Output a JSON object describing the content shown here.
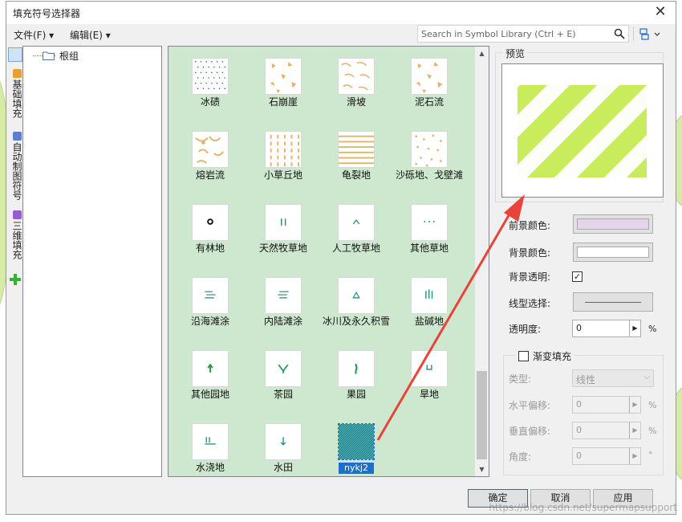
{
  "window": {
    "title": "填充符号选择器"
  },
  "menu": [
    {
      "label": "文件(F)"
    },
    {
      "label": "编辑(E)"
    }
  ],
  "search": {
    "placeholder": "Search in Symbol Library (Ctrl + E)"
  },
  "left_tabs": [
    {
      "label": "基础填充"
    },
    {
      "label": "自动制图符号"
    },
    {
      "label": "三维填充"
    }
  ],
  "tree": {
    "root_label": "根组"
  },
  "symbols": [
    {
      "label": "冰碛",
      "pattern": "dots"
    },
    {
      "label": "石崩崖",
      "pattern": "blobs"
    },
    {
      "label": "滑坡",
      "pattern": "arcs"
    },
    {
      "label": "泥石流",
      "pattern": "blobs"
    },
    {
      "label": "熔岩流",
      "pattern": "lava"
    },
    {
      "label": "小草丘地",
      "pattern": "dashes"
    },
    {
      "label": "龟裂地",
      "pattern": "stripes"
    },
    {
      "label": "沙砾地、戈壁滩",
      "pattern": "sand"
    },
    {
      "label": "有林地",
      "pattern": "ring"
    },
    {
      "label": "天然牧草地",
      "pattern": "bars2"
    },
    {
      "label": "人工牧草地",
      "pattern": "caret"
    },
    {
      "label": "其他草地",
      "pattern": "dots3"
    },
    {
      "label": "沿海滩涂",
      "pattern": "lines-coast"
    },
    {
      "label": "内陆滩涂",
      "pattern": "lines-inland"
    },
    {
      "label": "冰川及永久积雪",
      "pattern": "triangle"
    },
    {
      "label": "盐碱地",
      "pattern": "bars3"
    },
    {
      "label": "其他园地",
      "pattern": "sprout"
    },
    {
      "label": "茶园",
      "pattern": "vleaf"
    },
    {
      "label": "果园",
      "pattern": "seed"
    },
    {
      "label": "旱地",
      "pattern": "ushape"
    },
    {
      "label": "水浇地",
      "pattern": "waterland"
    },
    {
      "label": "水田",
      "pattern": "downarrow"
    },
    {
      "label": "nykj2",
      "pattern": "hatch",
      "selected": true
    }
  ],
  "preview": {
    "title": "预览",
    "stripe_color": "#c8ec5c"
  },
  "properties": {
    "fg_color_label": "前景颜色:",
    "fg_color": "#e4d4ea",
    "bg_color_label": "背景颜色:",
    "bg_color": "#ffffff",
    "bg_transparent_label": "背景透明:",
    "bg_transparent_check": "✓",
    "line_style_label": "线型选择:",
    "opacity_label": "透明度:",
    "opacity_value": "0",
    "opacity_unit": "%"
  },
  "gradient": {
    "label": "渐变填充",
    "type_label": "类型:",
    "type_value": "线性",
    "h_offset_label": "水平偏移:",
    "h_offset_value": "0",
    "h_offset_unit": "%",
    "v_offset_label": "垂直偏移:",
    "v_offset_value": "0",
    "v_offset_unit": "%",
    "angle_label": "角度:",
    "angle_value": "0",
    "angle_unit": "°"
  },
  "buttons": {
    "ok": "确定",
    "cancel": "取消",
    "apply": "应用"
  },
  "watermark": "https://blog.csdn.net/supermapsupport",
  "colors": {
    "grid_bg": "#cee8cf",
    "accent": "#1e6fc8",
    "arrow": "#e8443a"
  }
}
